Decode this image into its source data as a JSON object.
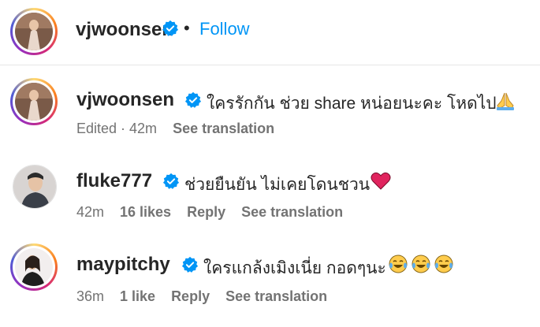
{
  "header": {
    "username": "vjwoonsen",
    "separator": "•",
    "follow_label": "Follow"
  },
  "comments": [
    {
      "username": "vjwoonsen",
      "text": "ใครรักกัน ช่วย share หน่อยนะคะ โหดไป",
      "emoji": "folded-hands-icon",
      "edited": "Edited · 42m",
      "see_translation": "See translation"
    },
    {
      "username": "fluke777",
      "text": "ช่วยยืนยัน ไม่เคยโดนชวน",
      "emoji": "red-heart-icon",
      "time": "42m",
      "likes": "16 likes",
      "reply": "Reply",
      "see_translation": "See translation"
    },
    {
      "username": "maypitchy",
      "text": "ใครแกล้งเมิงเนี่ย กอดๆนะ",
      "emoji": "tears-of-joy-icon",
      "time": "36m",
      "likes": "1 like",
      "reply": "Reply",
      "see_translation": "See translation"
    }
  ],
  "colors": {
    "follow_blue": "#0095f6",
    "verified_blue": "#0095f6",
    "muted_text": "#737373",
    "heart_red": "#e0245e"
  }
}
